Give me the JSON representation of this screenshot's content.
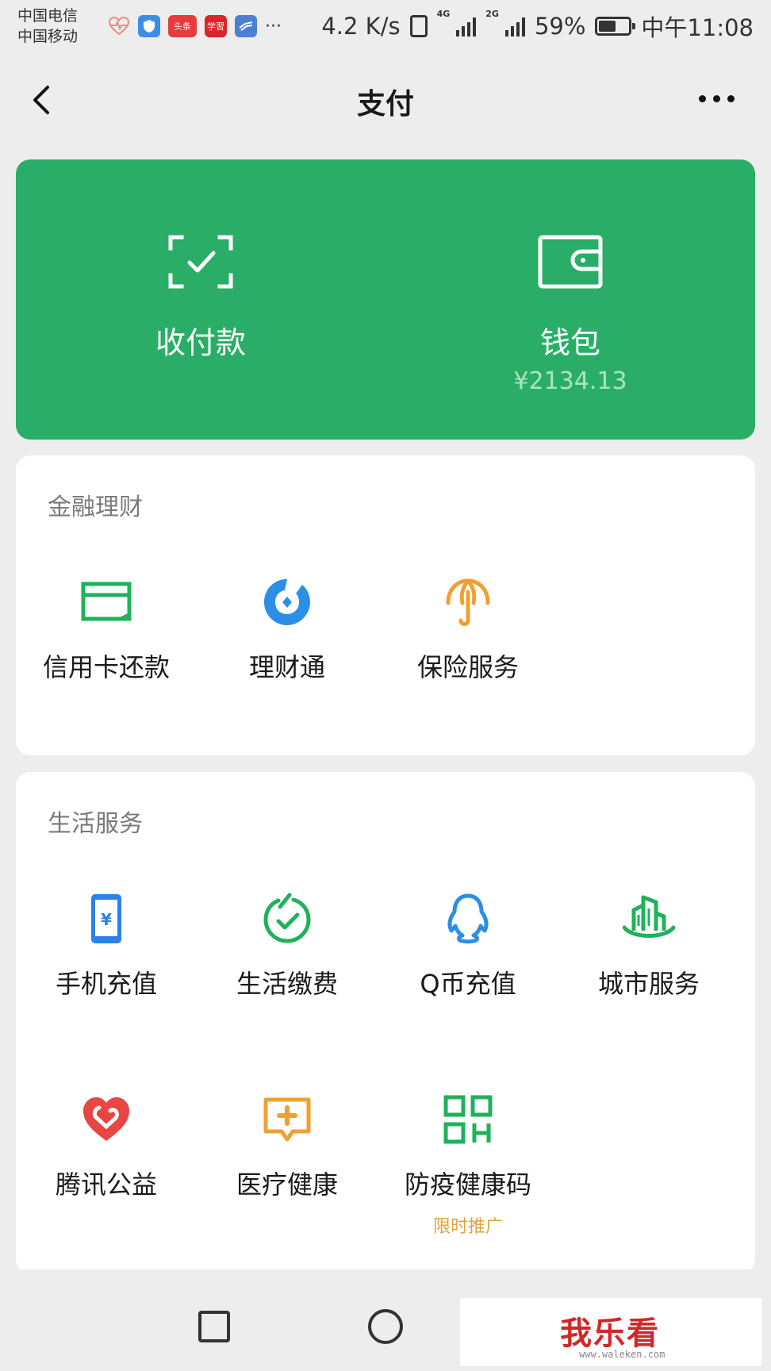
{
  "status_bar": {
    "carrier_1": "中国电信",
    "carrier_2": "中国移动",
    "app_icons": [
      "heart-rate-icon",
      "shield-app-icon",
      "toutiao-app-icon",
      "xuexi-app-icon",
      "hand-app-icon"
    ],
    "app_badge_toutiao": "头条",
    "app_badge_xuexi": "学習",
    "more": "···",
    "net_speed": "4.2 K/s",
    "net_tag_1": "4G",
    "net_tag_2": "2G",
    "battery_percent": "59%",
    "battery_level": 0.59,
    "time": "中午11:08"
  },
  "nav": {
    "title": "支付"
  },
  "top_card": {
    "color": "#2aae67",
    "items": [
      {
        "label": "收付款",
        "icon": "scan-check-icon"
      },
      {
        "label": "钱包",
        "sub": "¥2134.13",
        "icon": "wallet-icon"
      }
    ]
  },
  "finance": {
    "title": "金融理财",
    "items": [
      {
        "label": "信用卡还款",
        "icon": "credit-card-icon",
        "color": "#1fb25a"
      },
      {
        "label": "理财通",
        "icon": "licaitong-icon",
        "color": "#2b8fe8"
      },
      {
        "label": "保险服务",
        "icon": "umbrella-icon",
        "color": "#f0a030"
      }
    ]
  },
  "life": {
    "title": "生活服务",
    "items": [
      {
        "label": "手机充值",
        "icon": "phone-recharge-icon",
        "color": "#2b82e8"
      },
      {
        "label": "生活缴费",
        "icon": "utility-bill-icon",
        "color": "#1fb25a"
      },
      {
        "label": "Q币充值",
        "icon": "qq-penguin-icon",
        "color": "#2b8fe8"
      },
      {
        "label": "城市服务",
        "icon": "city-building-icon",
        "color": "#1fb25a"
      },
      {
        "label": "腾讯公益",
        "icon": "charity-heart-icon",
        "color": "#e84545"
      },
      {
        "label": "医疗健康",
        "icon": "medical-chat-icon",
        "color": "#f0a030"
      },
      {
        "label": "防疫健康码",
        "icon": "health-qr-icon",
        "color": "#1fb25a",
        "promo": "限时推广"
      }
    ]
  },
  "watermark": {
    "text": "我乐看",
    "url": "www.waleken.com"
  }
}
